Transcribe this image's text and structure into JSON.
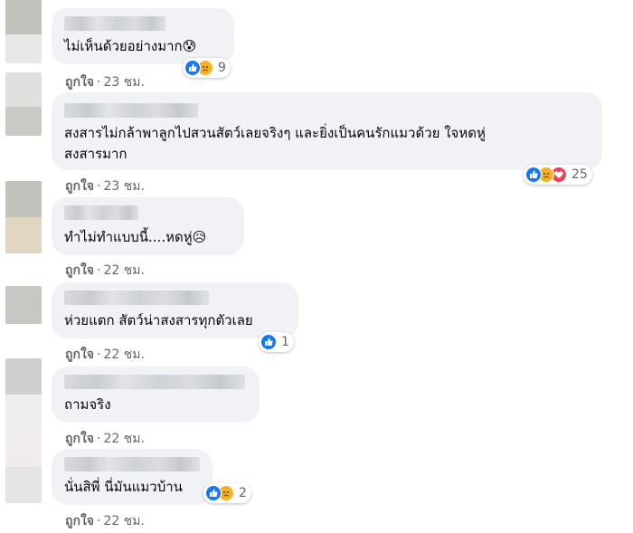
{
  "comments": [
    {
      "text_lines": [
        "ไม่เห็นด้วยอย่างมาก😰"
      ],
      "reactions": [
        "like",
        "sad"
      ],
      "reaction_count": "9",
      "like_label": "ถูกใจ",
      "dot": "·",
      "time": "23 ชม."
    },
    {
      "text_lines": [
        "สงสารไม่กล้าพาลูกไปสวนสัตว์เลยจริงๆ และยิ่งเป็นคนรักแมวด้วย ใจหดหู่",
        "สงสารมาก"
      ],
      "reactions": [
        "like",
        "sad",
        "love"
      ],
      "reaction_count": "25",
      "like_label": "ถูกใจ",
      "dot": "·",
      "time": "23 ชม."
    },
    {
      "text_lines": [
        "ทำไม่ทำแบบนี้....หดหู่😥"
      ],
      "reactions": [],
      "reaction_count": "",
      "like_label": "ถูกใจ",
      "dot": "·",
      "time": "22 ชม."
    },
    {
      "text_lines": [
        "ห่วยแตก สัตว์น่าสงสารทุกตัวเลย"
      ],
      "reactions": [
        "like"
      ],
      "reaction_count": "1",
      "like_label": "ถูกใจ",
      "dot": "·",
      "time": "22 ชม."
    },
    {
      "text_lines": [
        "ถามจริง"
      ],
      "reactions": [],
      "reaction_count": "",
      "like_label": "ถูกใจ",
      "dot": "·",
      "time": "22 ชม."
    },
    {
      "text_lines": [
        "นั่นสิพี่ นี่มันแมวบ้าน"
      ],
      "reactions": [
        "like",
        "sad"
      ],
      "reaction_count": "2",
      "like_label": "ถูกใจ",
      "dot": "·",
      "time": "22 ชม."
    }
  ],
  "colors": {
    "bubble": "#f0f2f5",
    "meta_text": "#65676b",
    "like": "#1877f2",
    "sad": "#f7b125",
    "love": "#f33e58"
  },
  "icons": {
    "like": "thumbs-up-icon",
    "sad": "sad-face-icon",
    "love": "heart-icon"
  }
}
